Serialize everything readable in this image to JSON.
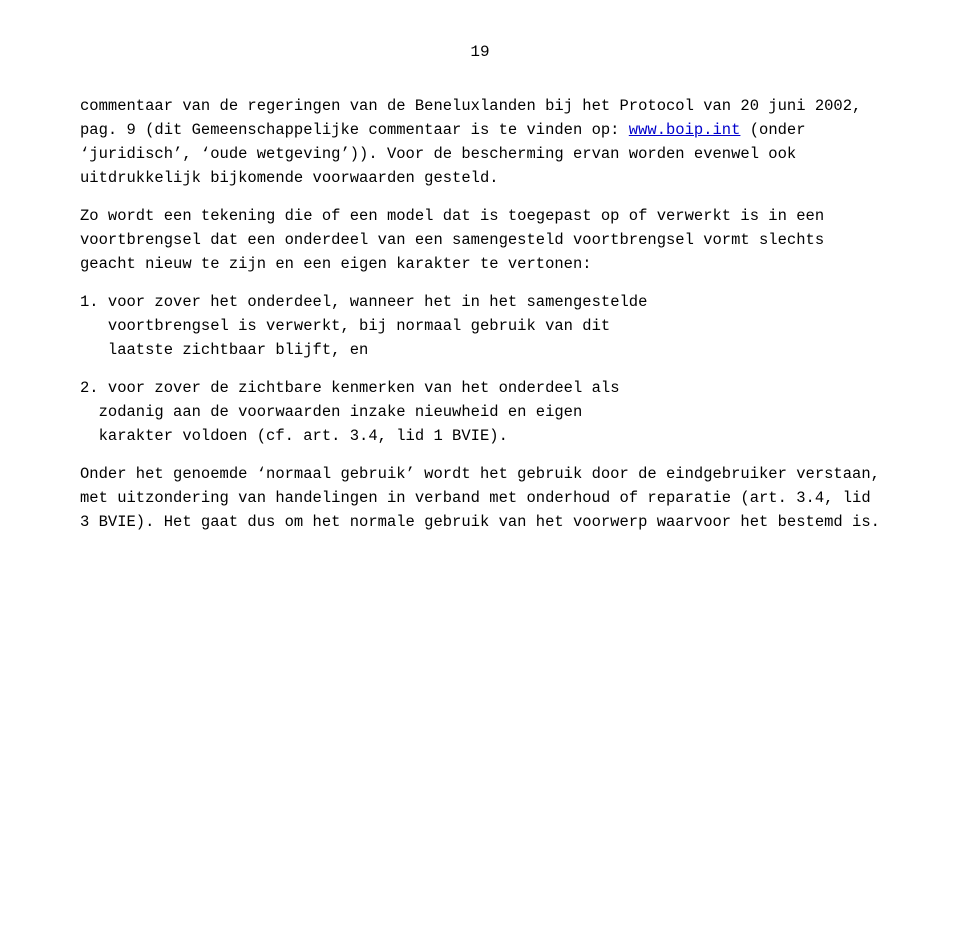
{
  "page": {
    "number": "19",
    "paragraphs": [
      {
        "id": "p1",
        "text": "commentaar van de regeringen van de Beneluxlanden bij het\nProtocol van 20 juni 2002, pag. 9 (dit Gemeenschappelijke\ncommentaar is te vinden op: ",
        "link_text": "www.boip.int",
        "link_href": "http://www.boip.int",
        "text_after": " (onder ‘juridisch’,\n‘oude wetgeving’)). Voor de bescherming ervan worden evenwel\nook uitdrukkelijk bijkomende voorwaarden gesteld."
      },
      {
        "id": "p2",
        "text": "Zo wordt een\ntekening die of een model dat is toegepast op of verwerkt is\nin een voortbrengsel dat een onderdeel van een samengesteld\nvoortbrengsel vormt slechts geacht nieuw te zijn en een eigen\nkarakter te vertonen:"
      },
      {
        "id": "list1",
        "number": "1.",
        "text": "voor zover het onderdeel, wanneer het in het samengestelde\n   voortbrengsel is verwerkt, bij normaal gebruik van dit\n   laatste zichtbaar blijft, en"
      },
      {
        "id": "list2",
        "number": "2.",
        "text": "voor zover de zichtbare kenmerken van het onderdeel als\n  zodanig aan de voorwaarden inzake nieuwheid en eigen\n  karakter voldoen (cf. art. 3.4, lid 1 BVIE)."
      },
      {
        "id": "p3",
        "text": "Onder het genoemde ‘normaal gebruik’ wordt het gebruik door de\neindgebruiker verstaan, met uitzondering van handelingen in\nverband met onderhoud of reparatie (art. 3.4, lid 3 BVIE). Het\ngaat dus om het normale gebruik van het voorwerp waarvoor het\nbestemd is."
      }
    ]
  }
}
